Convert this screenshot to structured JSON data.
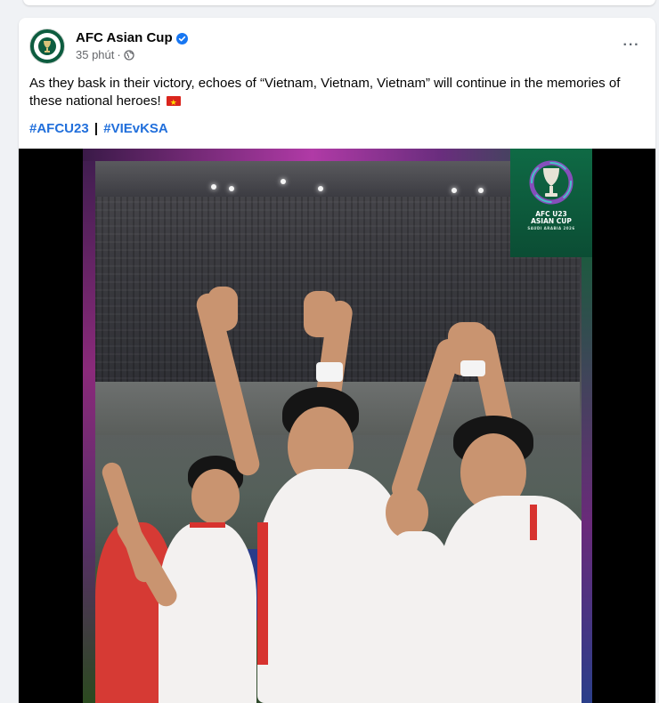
{
  "post": {
    "author": "AFC Asian Cup",
    "time": "35 phút",
    "meta_separator": "·",
    "more_label": "···",
    "text": "As they bask in their victory, echoes of “Vietnam, Vietnam, Vietnam” will continue in the memories of these national heroes!",
    "flag_icon": "vietnam-flag-icon",
    "hashtags": [
      "#AFCU23",
      "#VIEvKSA"
    ],
    "hashtag_separator": "|"
  },
  "media": {
    "badge_title_line1": "AFC U23",
    "badge_title_line2": "ASIAN CUP",
    "badge_subtitle": "SAUDI ARABIA 2026",
    "badge_icon": "trophy-icon"
  },
  "colors": {
    "link": "#216fdb",
    "badge_green": "#0f6a45",
    "verified_blue": "#1877f2"
  }
}
